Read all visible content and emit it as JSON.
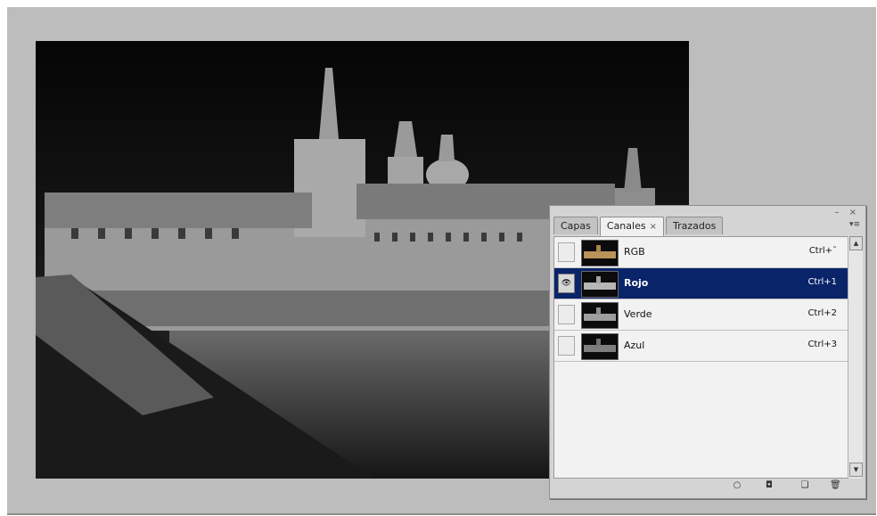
{
  "panel": {
    "controls": "– ×",
    "flyout": "▾≡",
    "tabs": [
      {
        "label": "Capas"
      },
      {
        "label": "Canales",
        "close": "×"
      },
      {
        "label": "Trazados"
      }
    ],
    "channels": [
      {
        "name": "RGB",
        "shortcut": "Ctrl+˜",
        "visible": false,
        "selected": false
      },
      {
        "name": "Rojo",
        "shortcut": "Ctrl+1",
        "visible": true,
        "selected": true
      },
      {
        "name": "Verde",
        "shortcut": "Ctrl+2",
        "visible": false,
        "selected": false
      },
      {
        "name": "Azul",
        "shortcut": "Ctrl+3",
        "visible": false,
        "selected": false
      }
    ],
    "scroll_up": "▲",
    "scroll_down": "▼",
    "footer_icons": {
      "load_selection": "○",
      "save_selection": "◘",
      "new_channel": "❏",
      "delete_channel": "🗑"
    }
  },
  "colors": {
    "selected_row": "#0a246a",
    "canvas_bg": "#bdbdbd",
    "panel_bg": "#d4d4d4"
  }
}
